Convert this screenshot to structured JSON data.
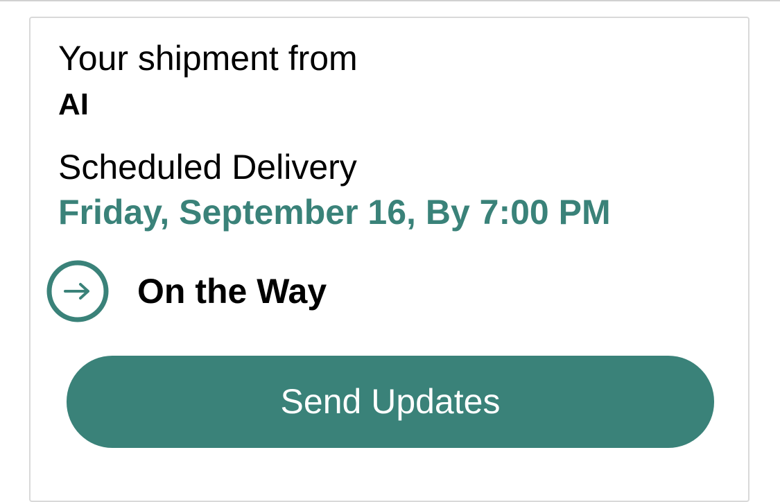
{
  "shipment": {
    "from_label": "Your shipment from",
    "shipper": "AI"
  },
  "delivery": {
    "label": "Scheduled Delivery",
    "date": "Friday, September 16, By 7:00 PM"
  },
  "status": {
    "icon": "arrow-right-circle-icon",
    "label": "On the Way"
  },
  "actions": {
    "send_updates_label": "Send Updates"
  },
  "colors": {
    "accent": "#3a8279",
    "card_border": "#d9d9d9",
    "text": "#000000"
  }
}
